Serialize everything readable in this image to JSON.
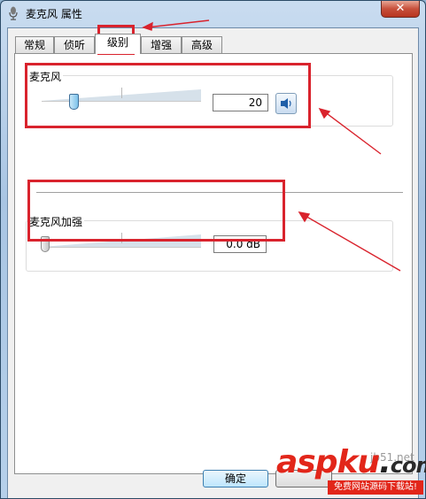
{
  "window": {
    "title": "麦克风 属性",
    "close_label": "✕"
  },
  "tabs": [
    {
      "label": "常规"
    },
    {
      "label": "侦听"
    },
    {
      "label": "级别",
      "active": true
    },
    {
      "label": "增强"
    },
    {
      "label": "高级"
    }
  ],
  "levels": {
    "microphone": {
      "label": "麦克风",
      "value_text": "20",
      "level": 20
    },
    "boost": {
      "label": "麦克风加强",
      "value_text": "0.0 dB",
      "level": 0
    }
  },
  "buttons": {
    "ok_label": "确定"
  },
  "watermark": {
    "site_small": "jb51.net",
    "brand_main": "aspku",
    "brand_dot": ".",
    "brand_tail": "com",
    "tagline": "免费网站源码下载站!"
  },
  "colors": {
    "annotation_red": "#d9232d",
    "title_bar": "#b6d0ea"
  },
  "icons": {
    "title": "microphone-icon",
    "mute": "speaker-icon"
  }
}
